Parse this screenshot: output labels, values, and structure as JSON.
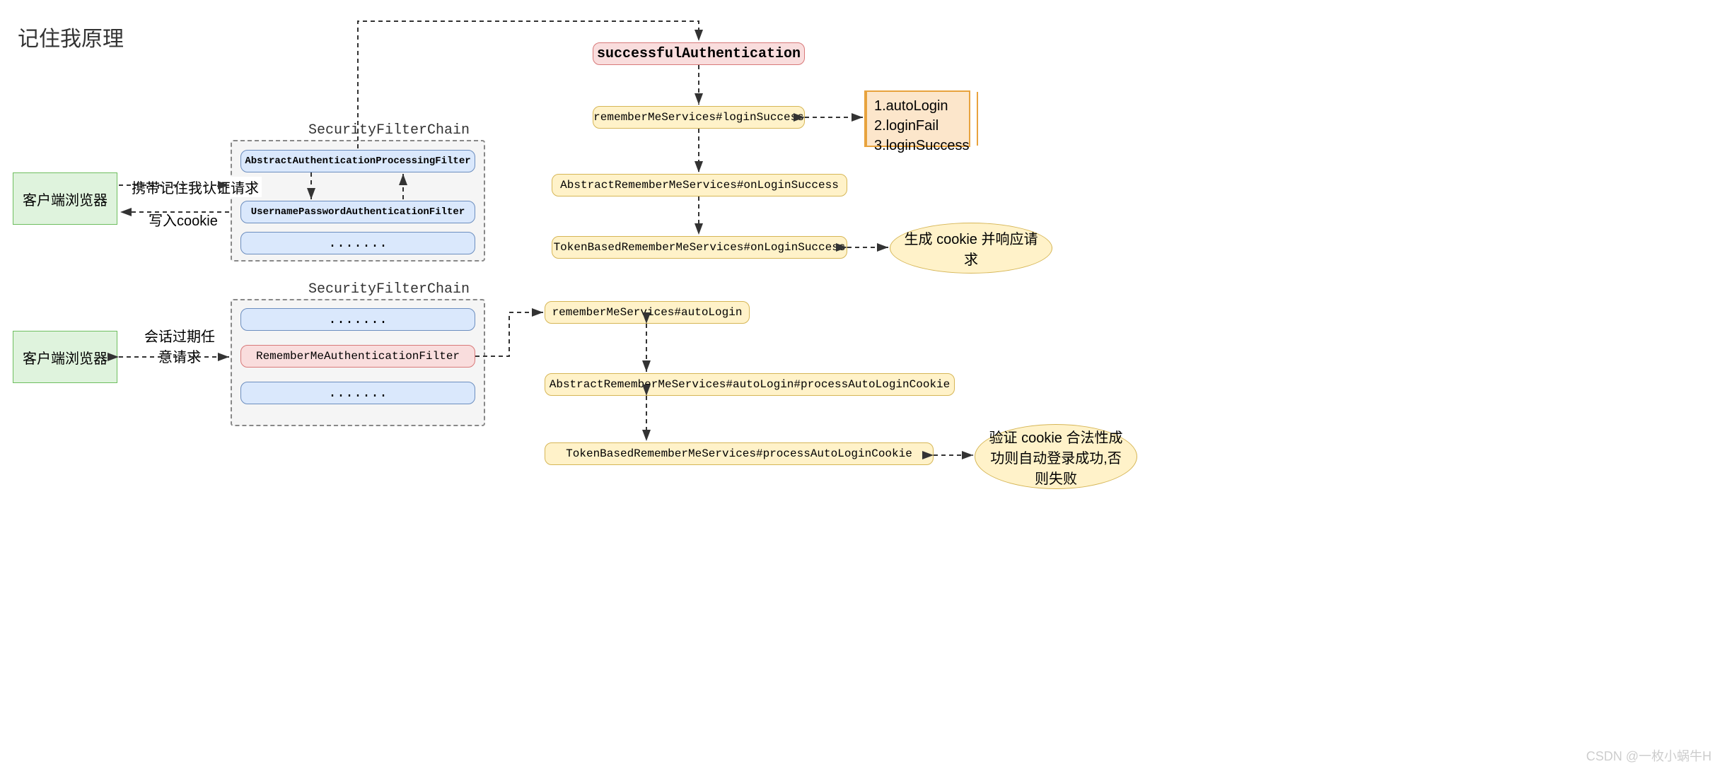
{
  "title": "记住我原理",
  "watermark": "CSDN @一枚小蜗牛H",
  "containers": {
    "chain1_label": "SecurityFilterChain",
    "chain2_label": "SecurityFilterChain"
  },
  "clients": {
    "browser1": "客户端浏览器",
    "browser2": "客户端浏览器"
  },
  "edge_labels": {
    "req1": "携带记住我认证请求",
    "resp1": "写入cookie",
    "req2": "会话过期任\n意请求"
  },
  "chain1": {
    "f1": "AbstractAuthenticationProcessingFilter",
    "f2": "UsernamePasswordAuthenticationFilter",
    "f3": "......."
  },
  "chain2": {
    "f1": ".......",
    "f2": "RememberMeAuthenticationFilter",
    "f3": "......."
  },
  "flow": {
    "success_auth": "successfulAuthentication",
    "rm_login_success": "rememberMeServices#loginSuccess",
    "abs_on_login": "AbstractRememberMeServices#onLoginSuccess",
    "token_on_login": "TokenBasedRememberMeServices#onLoginSuccess",
    "rm_auto_login": "rememberMeServices#autoLogin",
    "abs_auto_login": "AbstractRememberMeServices#autoLogin#processAutoLoginCookie",
    "token_auto_login": "TokenBasedRememberMeServices#processAutoLoginCookie"
  },
  "notes": {
    "methods": "1.autoLogin\n2.loginFail\n3.loginSuccess"
  },
  "ellipses": {
    "gen_cookie": "生成 cookie 并响应请\n求",
    "verify_cookie": "验证 cookie 合法性成\n功则自动登录成功,否\n则失败"
  }
}
